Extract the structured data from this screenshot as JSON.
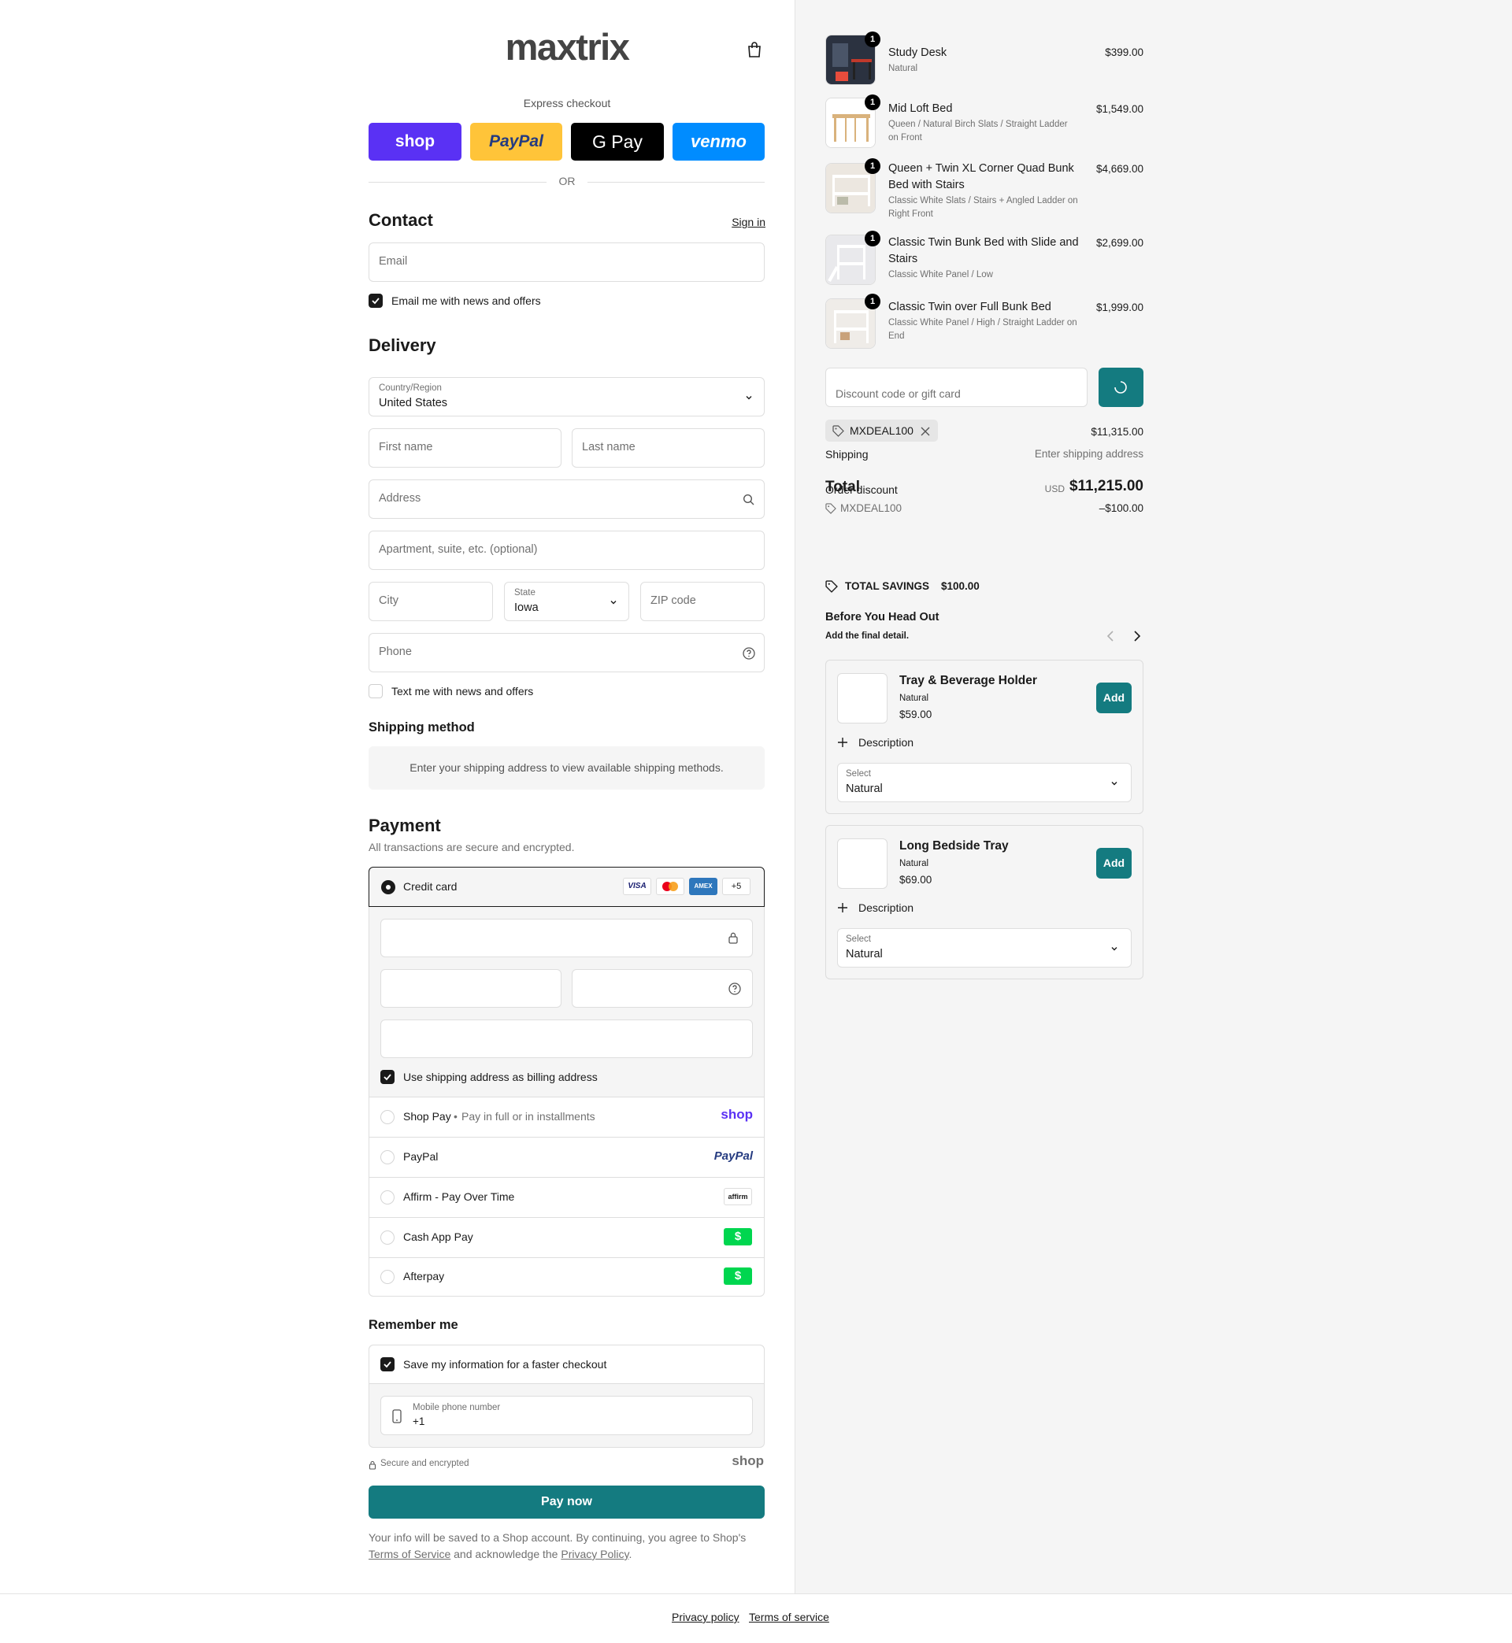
{
  "header": {
    "logo": "maxtrix",
    "cart_icon": "shopping-bag-icon"
  },
  "express": {
    "title": "Express checkout",
    "buttons": [
      "shop",
      "PayPal",
      "G Pay",
      "venmo"
    ],
    "divider": "OR"
  },
  "contact": {
    "title": "Contact",
    "sign_in": "Sign in",
    "email_placeholder": "Email",
    "news_label": "Email me with news and offers"
  },
  "delivery": {
    "title": "Delivery",
    "country_label": "Country/Region",
    "country_value": "United States",
    "first_name": "First name",
    "last_name": "Last name",
    "address": "Address",
    "apartment": "Apartment, suite, etc. (optional)",
    "city": "City",
    "state_label": "State",
    "state_value": "Iowa",
    "zip": "ZIP code",
    "phone": "Phone",
    "text_label": "Text me with news and offers"
  },
  "shipping": {
    "title": "Shipping method",
    "message": "Enter your shipping address to view available shipping methods."
  },
  "payment": {
    "title": "Payment",
    "subtitle": "All transactions are secure and encrypted.",
    "credit_card": "Credit card",
    "card_brands": [
      "VISA",
      "MC",
      "AMEX",
      "+5"
    ],
    "billing_label": "Use shipping address as billing address",
    "options": [
      {
        "label": "Shop Pay",
        "sub": "Pay in full or in installments",
        "logo": "shop"
      },
      {
        "label": "PayPal",
        "sub": "",
        "logo": "PayPal"
      },
      {
        "label": "Affirm - Pay Over Time",
        "sub": "",
        "logo": "affirm"
      },
      {
        "label": "Cash App Pay",
        "sub": "",
        "logo": "$"
      },
      {
        "label": "Afterpay",
        "sub": "",
        "logo": "$"
      }
    ]
  },
  "remember": {
    "title": "Remember me",
    "save_label": "Save my information for a faster checkout",
    "mobile_label": "Mobile phone number",
    "mobile_value": "+1",
    "secure": "Secure and encrypted",
    "shop_logo": "shop"
  },
  "pay_button": "Pay now",
  "legal": {
    "line1": "Your info will be saved to a Shop account. By continuing, you agree to Shop's",
    "terms": "Terms of Service",
    "and": " and acknowledge the ",
    "privacy": "Privacy Policy",
    "dot": "."
  },
  "cart": {
    "items": [
      {
        "qty": "1",
        "name": "Study Desk",
        "variant": "Natural",
        "price": "$399.00"
      },
      {
        "qty": "1",
        "name": "Mid Loft Bed",
        "variant": "Queen / Natural Birch Slats / Straight Ladder on Front",
        "price": "$1,549.00"
      },
      {
        "qty": "1",
        "name": "Queen + Twin XL Corner Quad Bunk Bed with Stairs",
        "variant": "Classic White Slats / Stairs + Angled Ladder on Right Front",
        "price": "$4,669.00"
      },
      {
        "qty": "1",
        "name": "Classic Twin Bunk Bed with Slide and Stairs",
        "variant": "Classic White Panel / Low",
        "price": "$2,699.00"
      },
      {
        "qty": "1",
        "name": "Classic Twin over Full Bunk Bed",
        "variant": "Classic White Panel / High / Straight Ladder on End",
        "price": "$1,999.00"
      }
    ]
  },
  "discount": {
    "placeholder": "Discount code or gift card",
    "code": "MXDEAL100"
  },
  "summary": {
    "subtotal": "$11,315.00",
    "shipping_label": "Shipping",
    "shipping_value": "Enter shipping address",
    "total_label": "Total",
    "order_discount": "Order discount",
    "currency": "USD",
    "total": "$11,215.00",
    "discount_code": "MXDEAL100",
    "discount_value": "–$100.00",
    "savings_label": "TOTAL SAVINGS",
    "savings_value": "$100.00"
  },
  "upsell": {
    "title": "Before You Head Out",
    "subtitle": "Add the final detail.",
    "items": [
      {
        "name": "Tray & Beverage Holder",
        "variant": "Natural",
        "price": "$59.00",
        "add": "Add",
        "description": "Description",
        "select_label": "Select",
        "select_value": "Natural"
      },
      {
        "name": "Long Bedside Tray",
        "variant": "Natural",
        "price": "$69.00",
        "add": "Add",
        "description": "Description",
        "select_label": "Select",
        "select_value": "Natural"
      }
    ]
  },
  "footer": {
    "privacy": "Privacy policy",
    "terms": "Terms of service"
  },
  "colors": {
    "accent": "#147b80",
    "shop": "#5a31f4",
    "paypal": "#ffc439",
    "venmo": "#008cff",
    "cashapp": "#00d64f"
  }
}
